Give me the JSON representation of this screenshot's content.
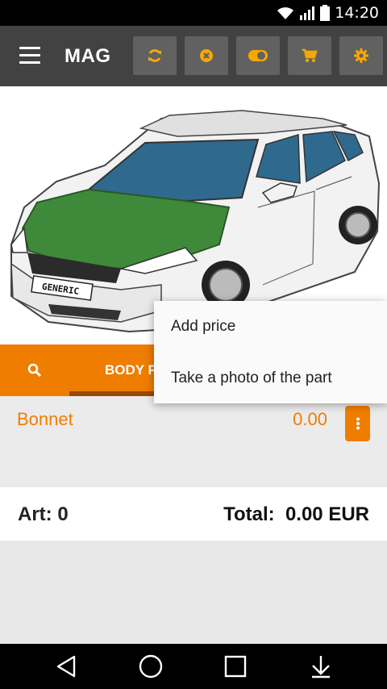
{
  "status_bar": {
    "time": "14:20",
    "icons": [
      "wifi-icon",
      "signal-icon",
      "battery-icon"
    ]
  },
  "app_bar": {
    "title": "MAG",
    "buttons": [
      "refresh-icon",
      "clear-icon",
      "toggle-icon",
      "cart-icon",
      "settings-icon"
    ]
  },
  "car": {
    "plate_text": "GENERIC"
  },
  "tabs": {
    "search_icon": "search-icon",
    "active_label": "BODY P"
  },
  "part": {
    "name": "Bonnet",
    "price": "0.00",
    "more_icon": "more-vert-icon"
  },
  "summary": {
    "art_label": "Art: 0",
    "total_label": "Total:  0.00 EUR"
  },
  "popup": {
    "items": [
      "Add price",
      "Take a photo of the part"
    ]
  },
  "colors": {
    "accent": "#ef7d00",
    "appbar": "#424242",
    "button": "#616161",
    "highlight_green": "#3f8a3a"
  }
}
